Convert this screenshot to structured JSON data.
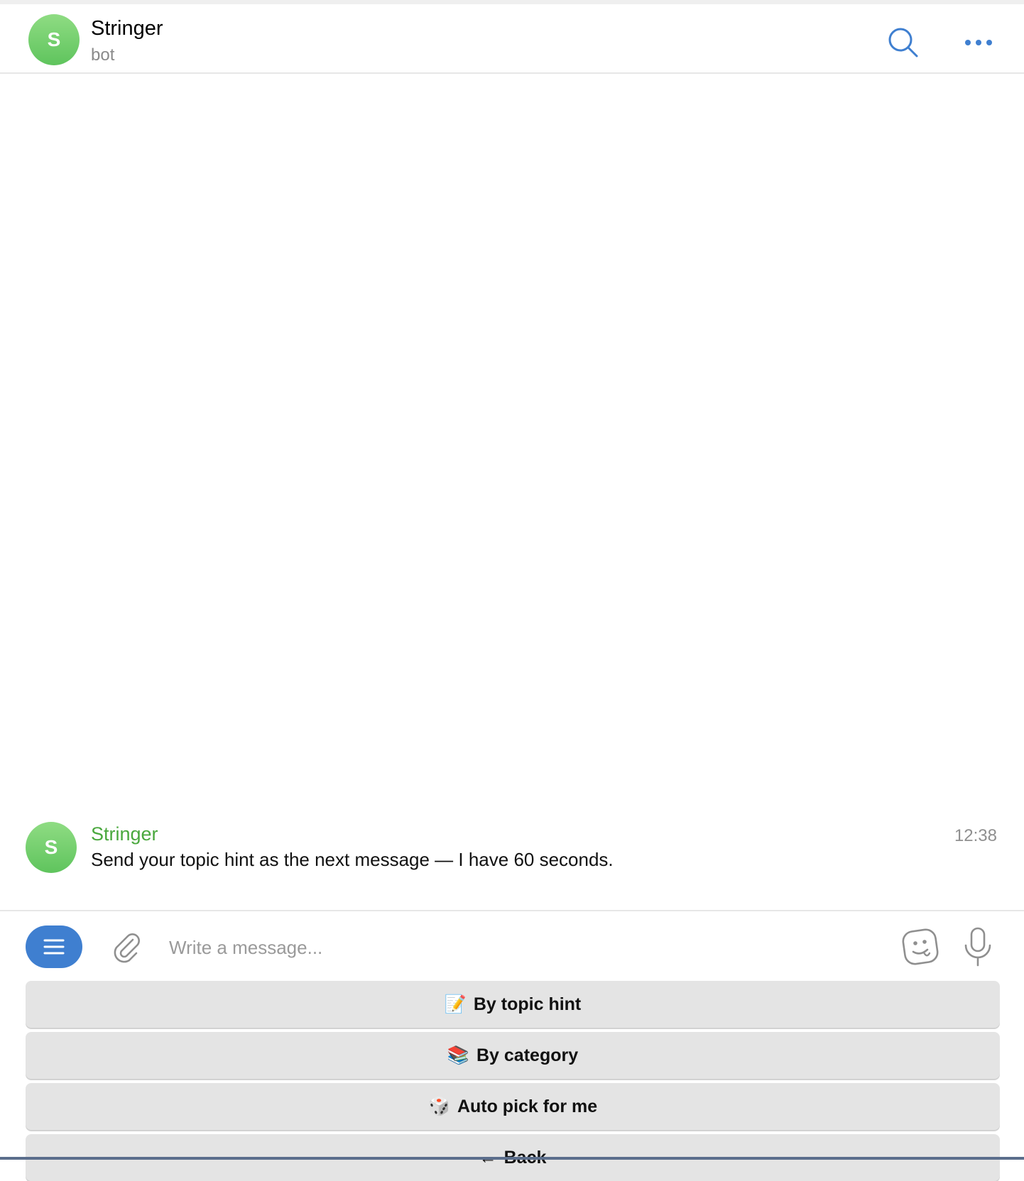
{
  "header": {
    "avatar_letter": "S",
    "title": "Stringer",
    "subtitle": "bot",
    "search_icon": "search-icon",
    "more_icon": "more-horizontal-icon",
    "accent_color": "#3f7fd0"
  },
  "messages": [
    {
      "avatar_letter": "S",
      "author": "Stringer",
      "text": "Send your topic hint as the next message — I have 60 seconds.",
      "time": "12:38",
      "author_color": "#4aa83e"
    }
  ],
  "composer": {
    "menu_icon": "menu-icon",
    "attach_icon": "paperclip-icon",
    "placeholder": "Write a message...",
    "value": "",
    "sticker_icon": "sticker-icon",
    "mic_icon": "microphone-icon"
  },
  "keyboard": {
    "buttons": [
      {
        "emoji": "📝",
        "label": "By topic hint"
      },
      {
        "emoji": "📚",
        "label": "By category"
      },
      {
        "emoji": "🎲",
        "label": "Auto pick for me"
      },
      {
        "emoji": "←",
        "label": "Back"
      }
    ]
  }
}
